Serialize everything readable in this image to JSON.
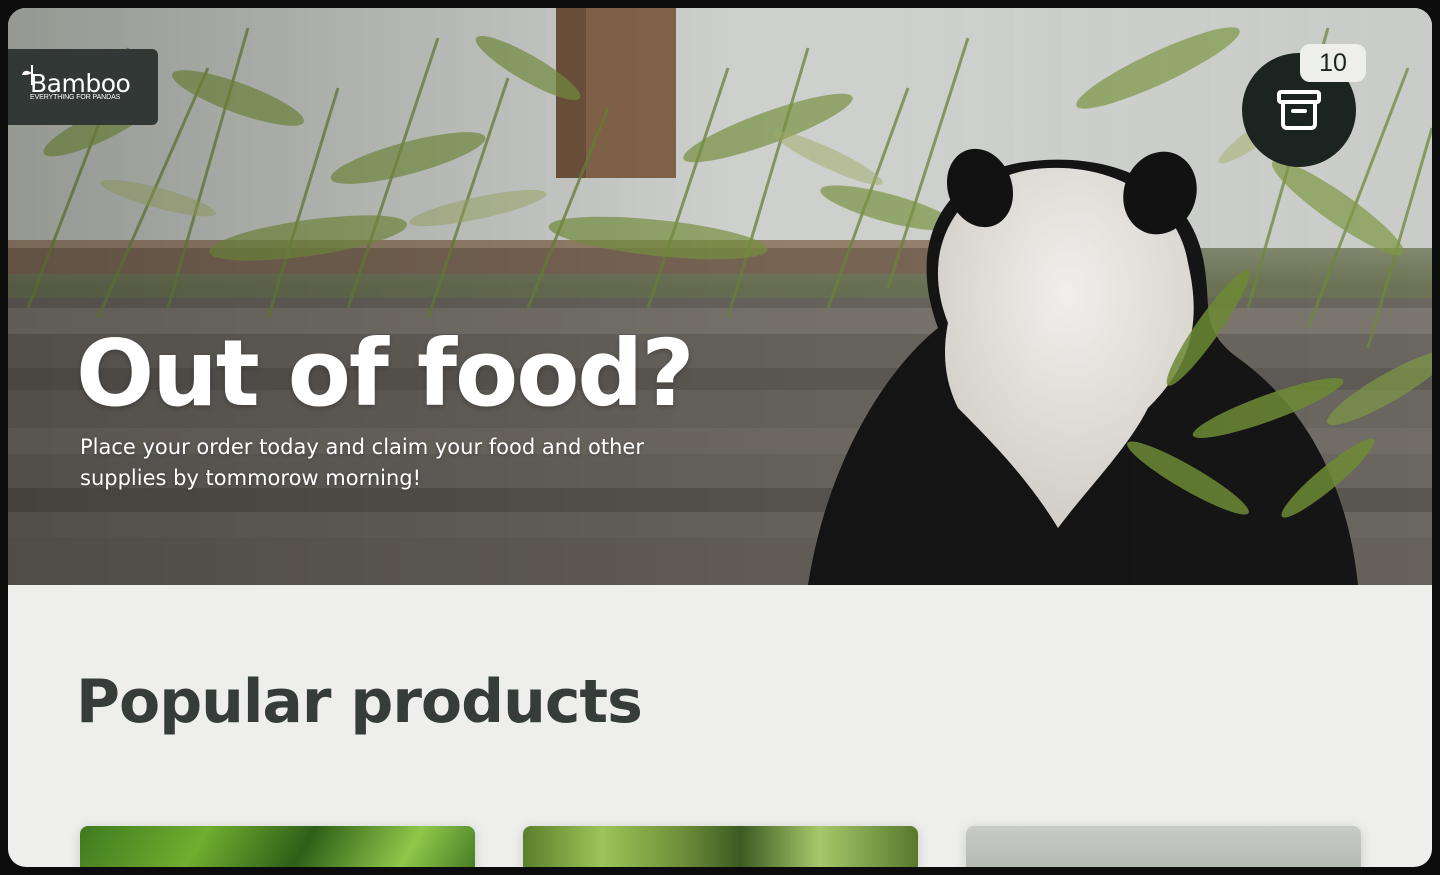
{
  "brand": {
    "name": "Bamboo",
    "tagline": "EVERYTHING FOR PANDAS"
  },
  "cart": {
    "count": "10",
    "icon": "archive-box-icon"
  },
  "hero": {
    "title": "Out of food?",
    "subtitle": "Place your order today and claim your food and other supplies by tommorow morning!"
  },
  "products": {
    "heading": "Popular products",
    "cards": [
      {
        "image": "bamboo-leaves"
      },
      {
        "image": "bamboo-grove"
      },
      {
        "image": "misty-bamboo"
      }
    ]
  },
  "colors": {
    "dark": "#1c2422",
    "background": "#eeefed",
    "heading": "#353c3a"
  }
}
